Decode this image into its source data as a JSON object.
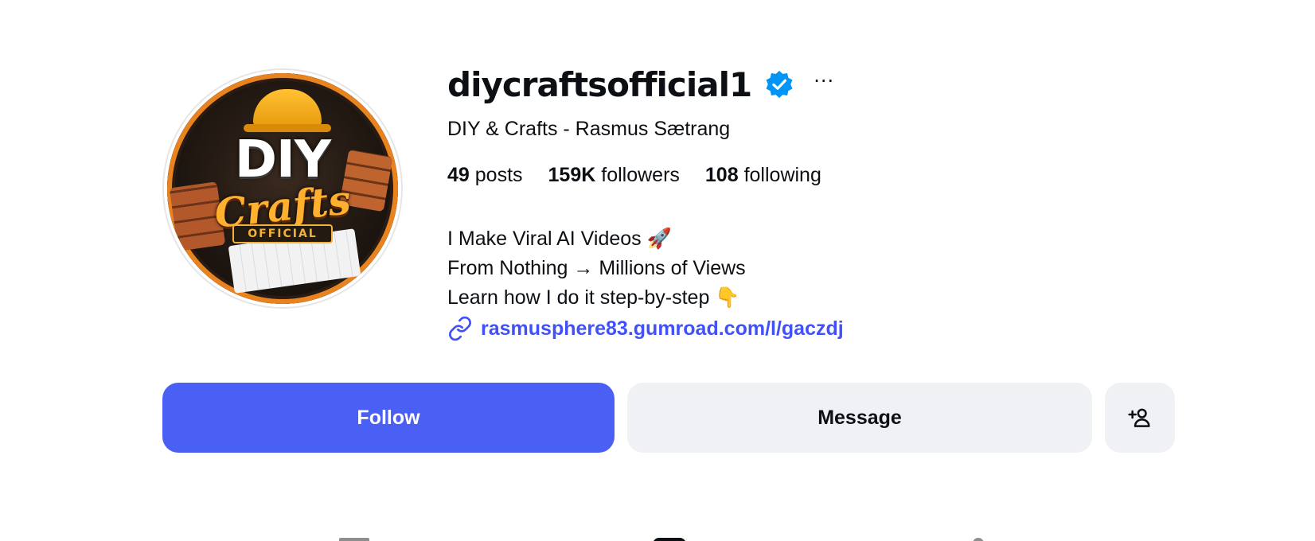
{
  "profile": {
    "username": "diycraftsofficial1",
    "full_name": "DIY & Crafts - Rasmus Sætrang",
    "avatar": {
      "title": "DIY",
      "subtitle": "Crafts",
      "badge": "OFFICIAL"
    }
  },
  "stats": [
    {
      "value": "49",
      "label": "posts"
    },
    {
      "value": "159K",
      "label": "followers"
    },
    {
      "value": "108",
      "label": "following"
    }
  ],
  "bio": [
    "I Make Viral AI Videos 🚀",
    "From Nothing → Millions of Views",
    "Learn how I do it step-by-step 👇"
  ],
  "link": {
    "text": "rasmusphere83.gumroad.com/l/gaczdj",
    "icon": "link-icon"
  },
  "buttons": {
    "follow": "Follow",
    "message": "Message",
    "add_user_icon": "add-user-icon"
  },
  "more_label": "···",
  "colors": {
    "follow_bg": "#4a5ff3",
    "secondary_bg": "#eff1f4",
    "link": "#4150f7",
    "verified": "#0095f6"
  }
}
